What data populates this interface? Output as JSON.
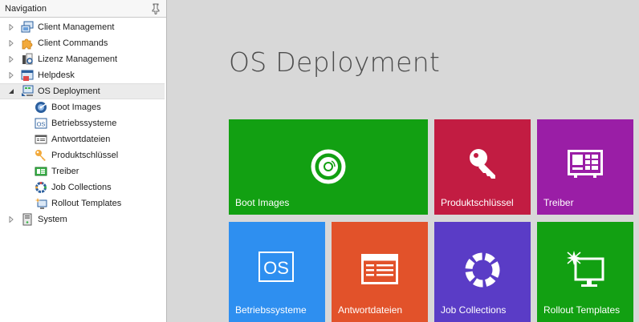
{
  "navigation": {
    "title": "Navigation",
    "items": [
      {
        "label": "Client Management",
        "icon": "client-management-icon",
        "expanded": false
      },
      {
        "label": "Client Commands",
        "icon": "puzzle-icon",
        "expanded": false
      },
      {
        "label": "Lizenz Management",
        "icon": "license-icon",
        "expanded": false
      },
      {
        "label": "Helpdesk",
        "icon": "helpdesk-icon",
        "expanded": false
      },
      {
        "label": "OS Deployment",
        "icon": "os-deployment-icon",
        "expanded": true,
        "selected": true,
        "children": [
          {
            "label": "Boot Images",
            "icon": "boot-images-icon"
          },
          {
            "label": "Betriebssysteme",
            "icon": "os-icon"
          },
          {
            "label": "Antwortdateien",
            "icon": "answer-files-icon"
          },
          {
            "label": "Produktschlüssel",
            "icon": "key-icon"
          },
          {
            "label": "Treiber",
            "icon": "driver-icon"
          },
          {
            "label": "Job Collections",
            "icon": "job-collections-icon"
          },
          {
            "label": "Rollout Templates",
            "icon": "rollout-templates-icon"
          }
        ]
      },
      {
        "label": "System",
        "icon": "system-icon",
        "expanded": false
      }
    ]
  },
  "main": {
    "title": "OS Deployment",
    "tiles": [
      {
        "label": "Boot Images",
        "icon": "disc-icon",
        "color": "#12a012"
      },
      {
        "label": "Produktschlüssel",
        "icon": "key-icon",
        "color": "#c21c42"
      },
      {
        "label": "Treiber",
        "icon": "driver-icon",
        "color": "#9a1ea6"
      },
      {
        "label": "Betriebssysteme",
        "icon": "os-icon",
        "color": "#2e8ff0"
      },
      {
        "label": "Antwortdateien",
        "icon": "answer-files-icon",
        "color": "#e2522a"
      },
      {
        "label": "Job Collections",
        "icon": "job-collections-icon",
        "color": "#5a3cc6"
      },
      {
        "label": "Rollout Templates",
        "icon": "rollout-templates-icon",
        "color": "#12a012"
      }
    ]
  }
}
